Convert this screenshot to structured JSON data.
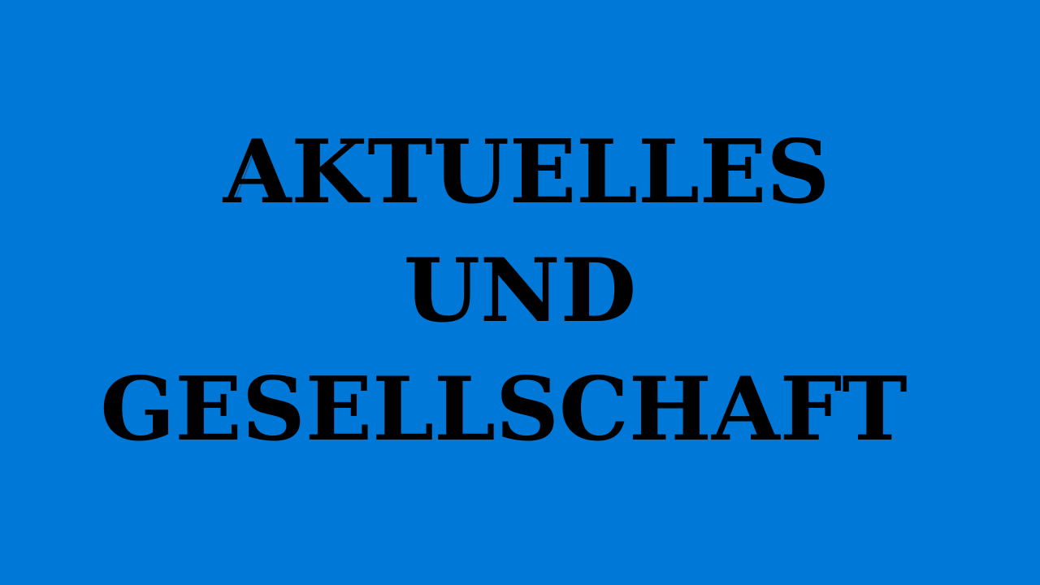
{
  "headline": {
    "lines": [
      "AKTUELLES",
      "UND",
      "GESELLSCHAFT"
    ]
  },
  "colors": {
    "background": "#0078d7",
    "text": "#000000"
  }
}
